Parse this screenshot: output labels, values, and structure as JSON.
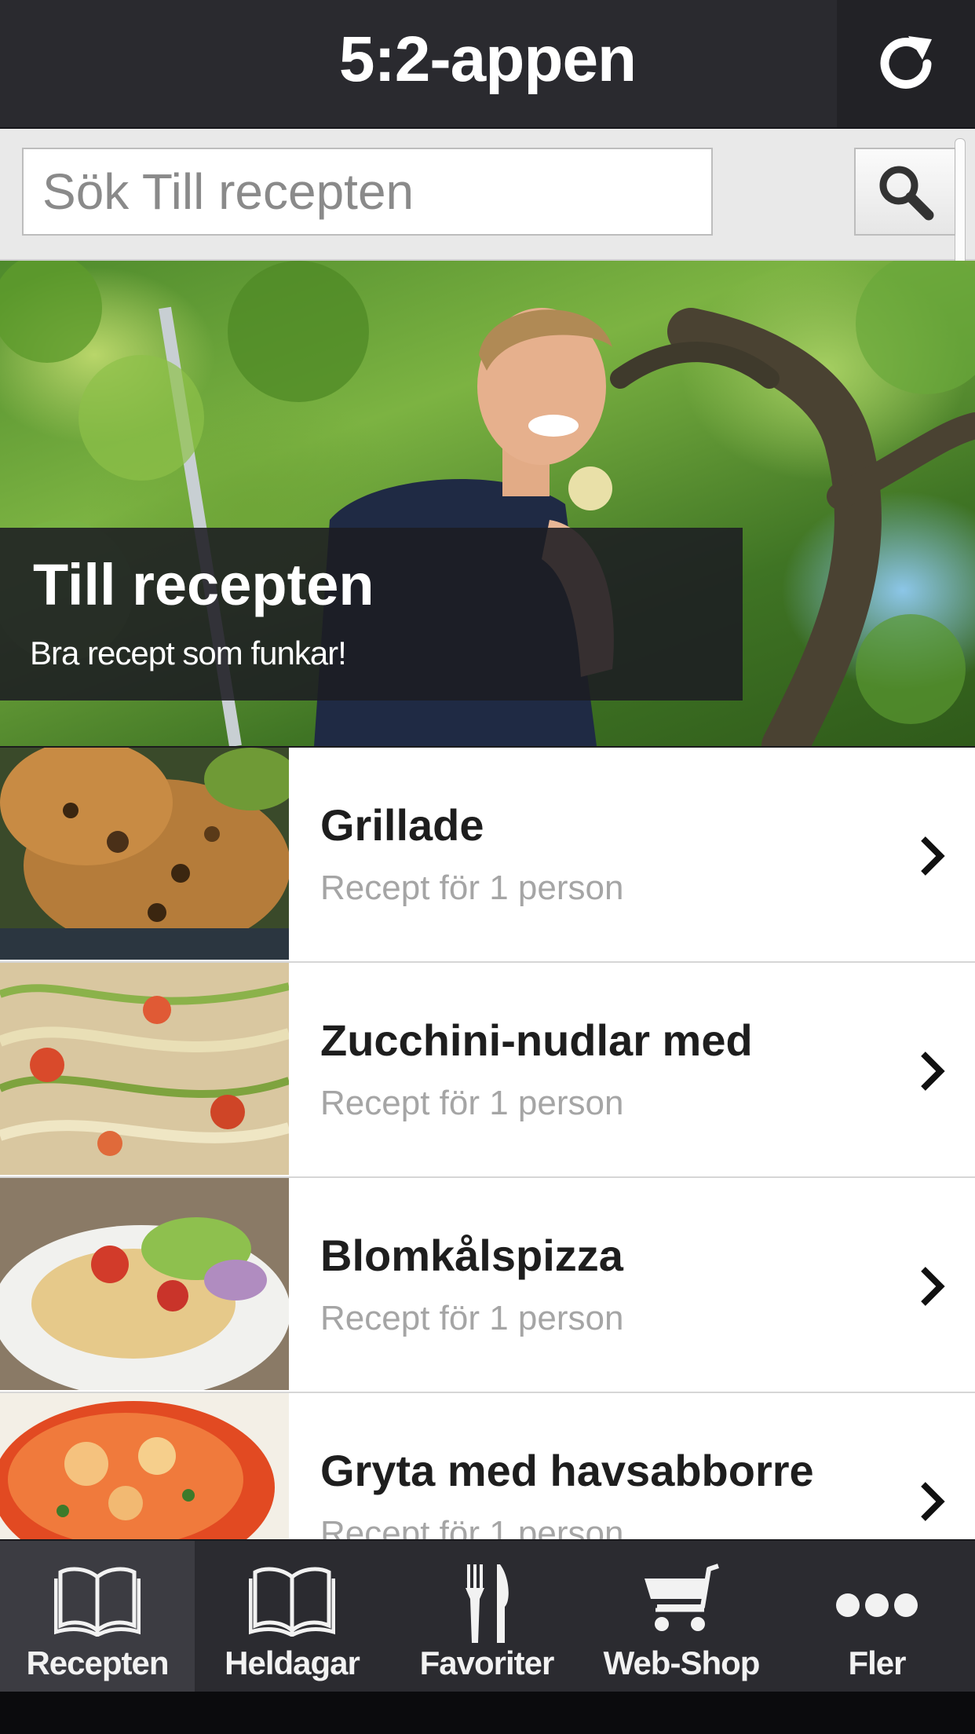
{
  "header": {
    "title": "5:2-appen",
    "refresh_icon": "refresh-icon"
  },
  "search": {
    "placeholder": "Sök Till recepten",
    "search_icon": "search-icon"
  },
  "hero": {
    "title": "Till recepten",
    "subtitle": "Bra recept som funkar!"
  },
  "recipes": [
    {
      "title": "Grillade",
      "subtitle": "Recept för 1 person"
    },
    {
      "title": "Zucchini-nudlar med",
      "subtitle": "Recept för 1 person"
    },
    {
      "title": "Blomkålspizza",
      "subtitle": "Recept för 1 person"
    },
    {
      "title": "Gryta med havsabborre",
      "subtitle": "Recept för 1 person"
    }
  ],
  "tabbar": {
    "items": [
      {
        "label": "Recepten",
        "icon": "book-icon",
        "active": true
      },
      {
        "label": "Heldagar",
        "icon": "book-icon",
        "active": false
      },
      {
        "label": "Favoriter",
        "icon": "fork-knife-icon",
        "active": false
      },
      {
        "label": "Web-Shop",
        "icon": "cart-icon",
        "active": false
      },
      {
        "label": "Fler",
        "icon": "more-icon",
        "active": false
      }
    ]
  },
  "colors": {
    "header_bg": "#2a2a2f",
    "tabbar_bg": "#2b2b30",
    "tab_active_bg": "#3c3c42",
    "subtitle_gray": "#a5a5a5"
  }
}
